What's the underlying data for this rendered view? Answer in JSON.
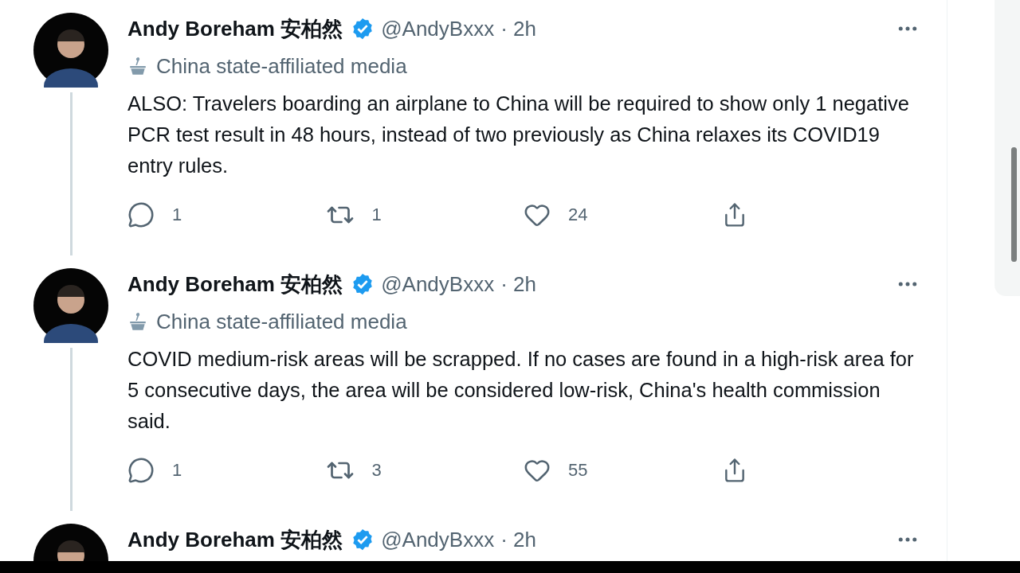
{
  "tweets": [
    {
      "author": "Andy Boreham 安柏然",
      "verified": true,
      "handle": "@AndyBxxx",
      "time": "· 2h",
      "affiliation": "China state-affiliated media",
      "text": "ALSO: Travelers boarding an airplane to China will be required to show only 1 negative PCR test result in 48 hours, instead of two previously as China relaxes its COVID19 entry rules.",
      "replies": "1",
      "retweets": "1",
      "likes": "24"
    },
    {
      "author": "Andy Boreham 安柏然",
      "verified": true,
      "handle": "@AndyBxxx",
      "time": "· 2h",
      "affiliation": "China state-affiliated media",
      "text": "COVID medium-risk areas will be scrapped. If no cases are found in a high-risk area for 5 consecutive days, the area will be considered low-risk, China's health commission said.",
      "replies": "1",
      "retweets": "3",
      "likes": "55"
    },
    {
      "author": "Andy Boreham 安柏然",
      "verified": true,
      "handle": "@AndyBxxx",
      "time": "· 2h"
    }
  ]
}
